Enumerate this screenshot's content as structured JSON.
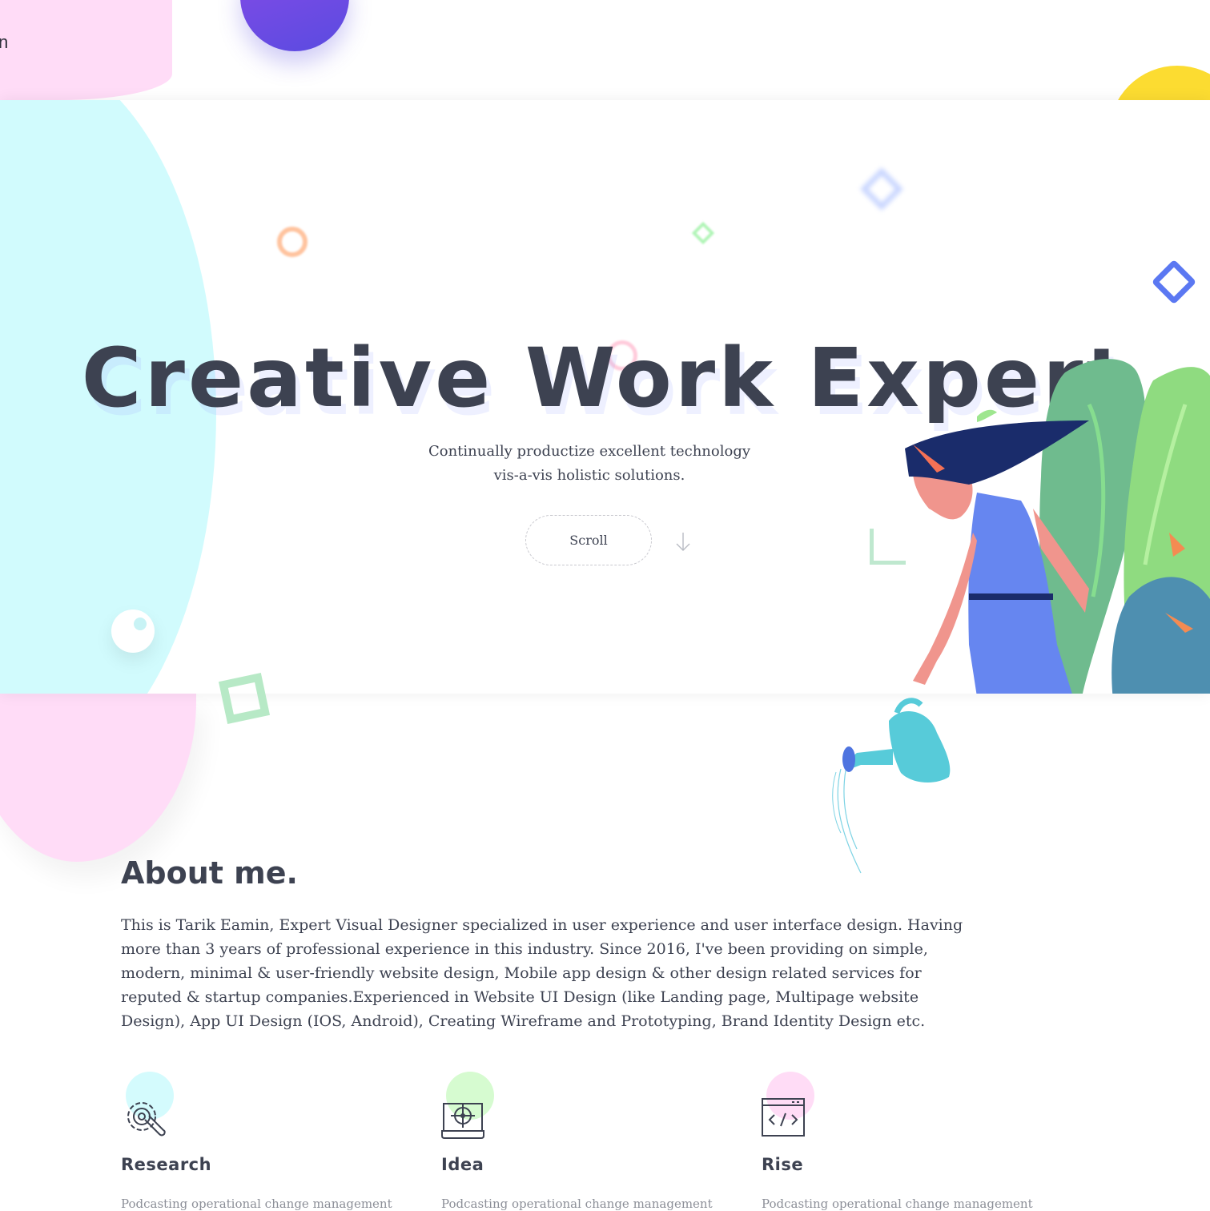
{
  "header": {
    "logo_fragment": "n"
  },
  "hero": {
    "title": "Creative Work Expert",
    "subtitle_line1": "Continually productize excellent technology",
    "subtitle_line2": "vis-a-vis holistic solutions.",
    "scroll_label": "Scroll"
  },
  "about": {
    "title": "About me.",
    "text": "This is Tarik Eamin, Expert Visual Designer specialized in user experience and user interface design. Having more than 3 years of professional experience in this industry. Since 2016, I've been providing on simple, modern, minimal & user-friendly website design, Mobile app design & other design related services for reputed & startup companies.Experienced in Website UI Design (like Landing page, Multipage website Design), App UI Design (IOS, Android), Creating Wireframe and Prototyping, Brand Identity Design etc."
  },
  "features": [
    {
      "title": "Research",
      "desc": "Podcasting operational change management",
      "icon": "gear-wrench-icon",
      "accent": "#d4fbfd"
    },
    {
      "title": "Idea",
      "desc": "Podcasting operational change management",
      "icon": "laptop-target-icon",
      "accent": "#d6fbd0"
    },
    {
      "title": "Rise",
      "desc": "Podcasting operational change management",
      "icon": "code-window-icon",
      "accent": "#ffdcf6"
    }
  ],
  "colors": {
    "text": "#3d4251",
    "cyan": "#d1fbfd",
    "pink": "#ffdcf7",
    "purple": "#6a4be6",
    "yellow": "#fcdc31"
  }
}
